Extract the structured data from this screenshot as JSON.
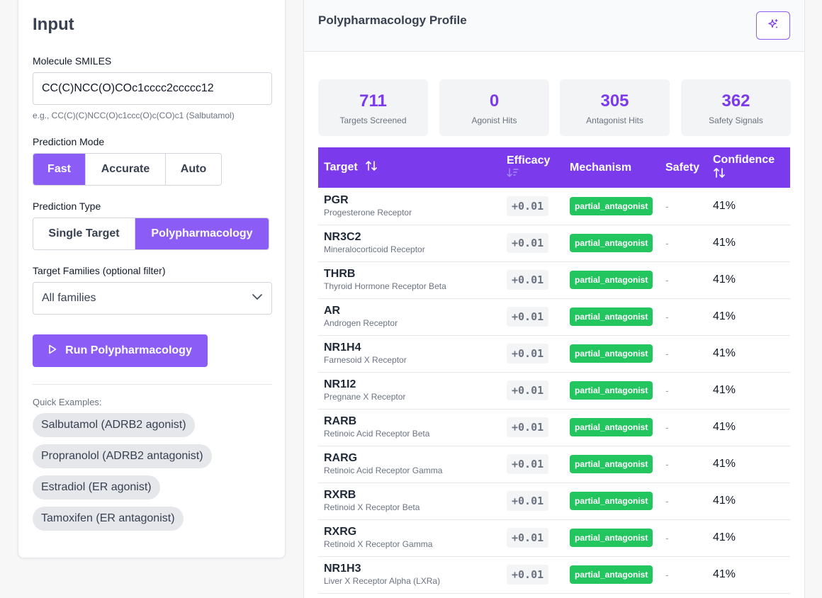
{
  "input": {
    "title": "Input",
    "smiles_label": "Molecule SMILES",
    "smiles_value": "CC(C)NCC(O)COc1cccc2ccccc12",
    "smiles_hint": "e.g., CC(C)(C)NCC(O)c1ccc(O)c(CO)c1 (Salbutamol)",
    "mode_label": "Prediction Mode",
    "modes": [
      "Fast",
      "Accurate",
      "Auto"
    ],
    "type_label": "Prediction Type",
    "types": [
      "Single Target",
      "Polypharmacology"
    ],
    "families_label": "Target Families (optional filter)",
    "families_value": "All families",
    "run_label": "Run Polypharmacology",
    "quick_label": "Quick Examples:",
    "examples": [
      "Salbutamol (ADRB2 agonist)",
      "Propranolol (ADRB2 antagonist)",
      "Estradiol (ER agonist)",
      "Tamoxifen (ER antagonist)"
    ]
  },
  "results": {
    "title": "Polypharmacology Profile",
    "stats": [
      {
        "value": "711",
        "label": "Targets Screened"
      },
      {
        "value": "0",
        "label": "Agonist Hits"
      },
      {
        "value": "305",
        "label": "Antagonist Hits"
      },
      {
        "value": "362",
        "label": "Safety Signals"
      }
    ],
    "columns": {
      "target": "Target",
      "efficacy": "Efficacy",
      "mechanism": "Mechanism",
      "safety": "Safety",
      "confidence": "Confidence"
    },
    "rows": [
      {
        "symbol": "PGR",
        "name": "Progesterone Receptor",
        "efficacy": "+0.01",
        "mechanism": "partial_antagonist",
        "safety": "-",
        "confidence": "41%"
      },
      {
        "symbol": "NR3C2",
        "name": "Mineralocorticoid Receptor",
        "efficacy": "+0.01",
        "mechanism": "partial_antagonist",
        "safety": "-",
        "confidence": "41%"
      },
      {
        "symbol": "THRB",
        "name": "Thyroid Hormone Receptor Beta",
        "efficacy": "+0.01",
        "mechanism": "partial_antagonist",
        "safety": "-",
        "confidence": "41%"
      },
      {
        "symbol": "AR",
        "name": "Androgen Receptor",
        "efficacy": "+0.01",
        "mechanism": "partial_antagonist",
        "safety": "-",
        "confidence": "41%"
      },
      {
        "symbol": "NR1H4",
        "name": "Farnesoid X Receptor",
        "efficacy": "+0.01",
        "mechanism": "partial_antagonist",
        "safety": "-",
        "confidence": "41%"
      },
      {
        "symbol": "NR1I2",
        "name": "Pregnane X Receptor",
        "efficacy": "+0.01",
        "mechanism": "partial_antagonist",
        "safety": "-",
        "confidence": "41%"
      },
      {
        "symbol": "RARB",
        "name": "Retinoic Acid Receptor Beta",
        "efficacy": "+0.01",
        "mechanism": "partial_antagonist",
        "safety": "-",
        "confidence": "41%"
      },
      {
        "symbol": "RARG",
        "name": "Retinoic Acid Receptor Gamma",
        "efficacy": "+0.01",
        "mechanism": "partial_antagonist",
        "safety": "-",
        "confidence": "41%"
      },
      {
        "symbol": "RXRB",
        "name": "Retinoid X Receptor Beta",
        "efficacy": "+0.01",
        "mechanism": "partial_antagonist",
        "safety": "-",
        "confidence": "41%"
      },
      {
        "symbol": "RXRG",
        "name": "Retinoid X Receptor Gamma",
        "efficacy": "+0.01",
        "mechanism": "partial_antagonist",
        "safety": "-",
        "confidence": "41%"
      },
      {
        "symbol": "NR1H3",
        "name": "Liver X Receptor Alpha (LXRa)",
        "efficacy": "+0.01",
        "mechanism": "partial_antagonist",
        "safety": "-",
        "confidence": "41%"
      }
    ]
  },
  "colors": {
    "accent": "#8b5cf6",
    "header": "#7c3aed",
    "mechanism_badge": "#22c55e"
  },
  "icons": {
    "run": "play-icon",
    "select": "chevron-down-icon",
    "header_action": "sparkle-icon",
    "sort": "sort-icon"
  }
}
